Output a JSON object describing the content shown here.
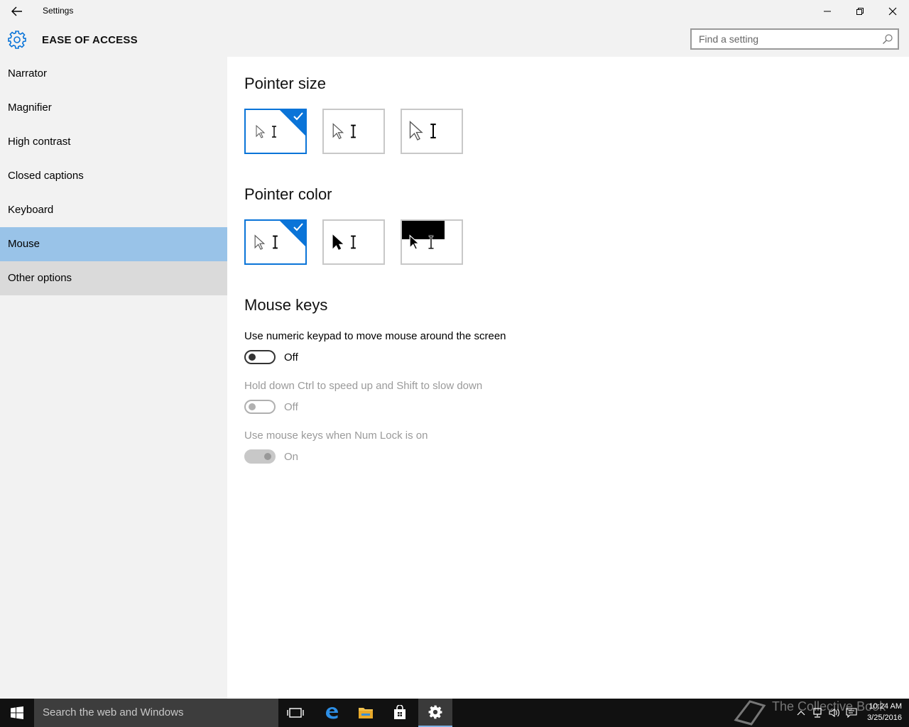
{
  "window": {
    "title": "Settings",
    "section_title": "EASE OF ACCESS",
    "search_placeholder": "Find a setting"
  },
  "sidebar": {
    "items": [
      {
        "label": "Narrator"
      },
      {
        "label": "Magnifier"
      },
      {
        "label": "High contrast"
      },
      {
        "label": "Closed captions"
      },
      {
        "label": "Keyboard"
      },
      {
        "label": "Mouse",
        "selected": true
      },
      {
        "label": "Other options",
        "hovered": true
      }
    ]
  },
  "main": {
    "pointer_size": {
      "heading": "Pointer size",
      "options": [
        "small",
        "medium",
        "large"
      ],
      "selected": "small"
    },
    "pointer_color": {
      "heading": "Pointer color",
      "options": [
        "white",
        "black",
        "inverted"
      ],
      "selected": "white"
    },
    "mouse_keys": {
      "heading": "Mouse keys",
      "settings": [
        {
          "label": "Use numeric keypad to move mouse around the screen",
          "state": "Off",
          "enabled": true
        },
        {
          "label": "Hold down Ctrl to speed up and Shift to slow down",
          "state": "Off",
          "enabled": false
        },
        {
          "label": "Use mouse keys when Num Lock is on",
          "state": "On",
          "enabled": false
        }
      ]
    }
  },
  "taskbar": {
    "search_placeholder": "Search the web and Windows",
    "watermark": "The Collective Book",
    "time": "10:24 AM",
    "date": "3/25/2016"
  },
  "colors": {
    "accent": "#0a74d8",
    "selected_nav": "#99c3e8",
    "sidebar_bg": "#f2f2f2"
  }
}
